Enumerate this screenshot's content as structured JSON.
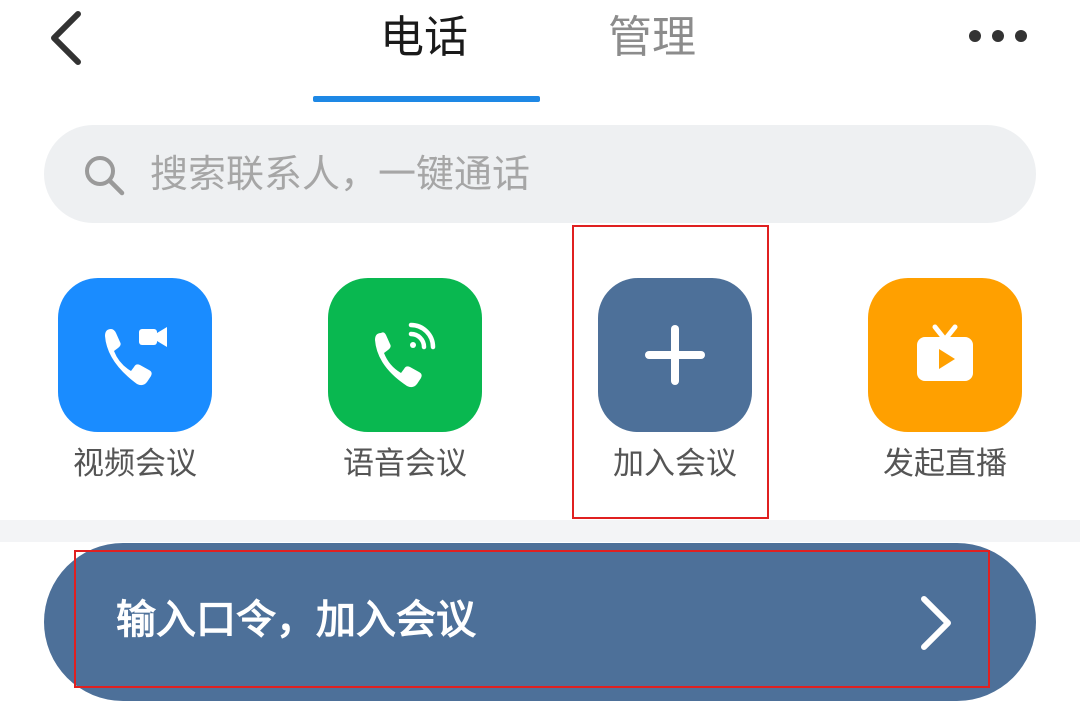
{
  "header": {
    "tabs": [
      {
        "label": "电话",
        "active": true
      },
      {
        "label": "管理",
        "active": false
      }
    ],
    "accent_color": "#1e88e5"
  },
  "search": {
    "placeholder": "搜索联系人，一键通话"
  },
  "actions": [
    {
      "label": "视频会议",
      "icon": "video-call-icon",
      "color": "#1a8cff"
    },
    {
      "label": "语音会议",
      "icon": "voice-call-icon",
      "color": "#09b850"
    },
    {
      "label": "加入会议",
      "icon": "plus-icon",
      "color": "#4d7099"
    },
    {
      "label": "发起直播",
      "icon": "live-tv-icon",
      "color": "#ffa000"
    }
  ],
  "command_button": {
    "label": "输入口令，加入会议"
  }
}
